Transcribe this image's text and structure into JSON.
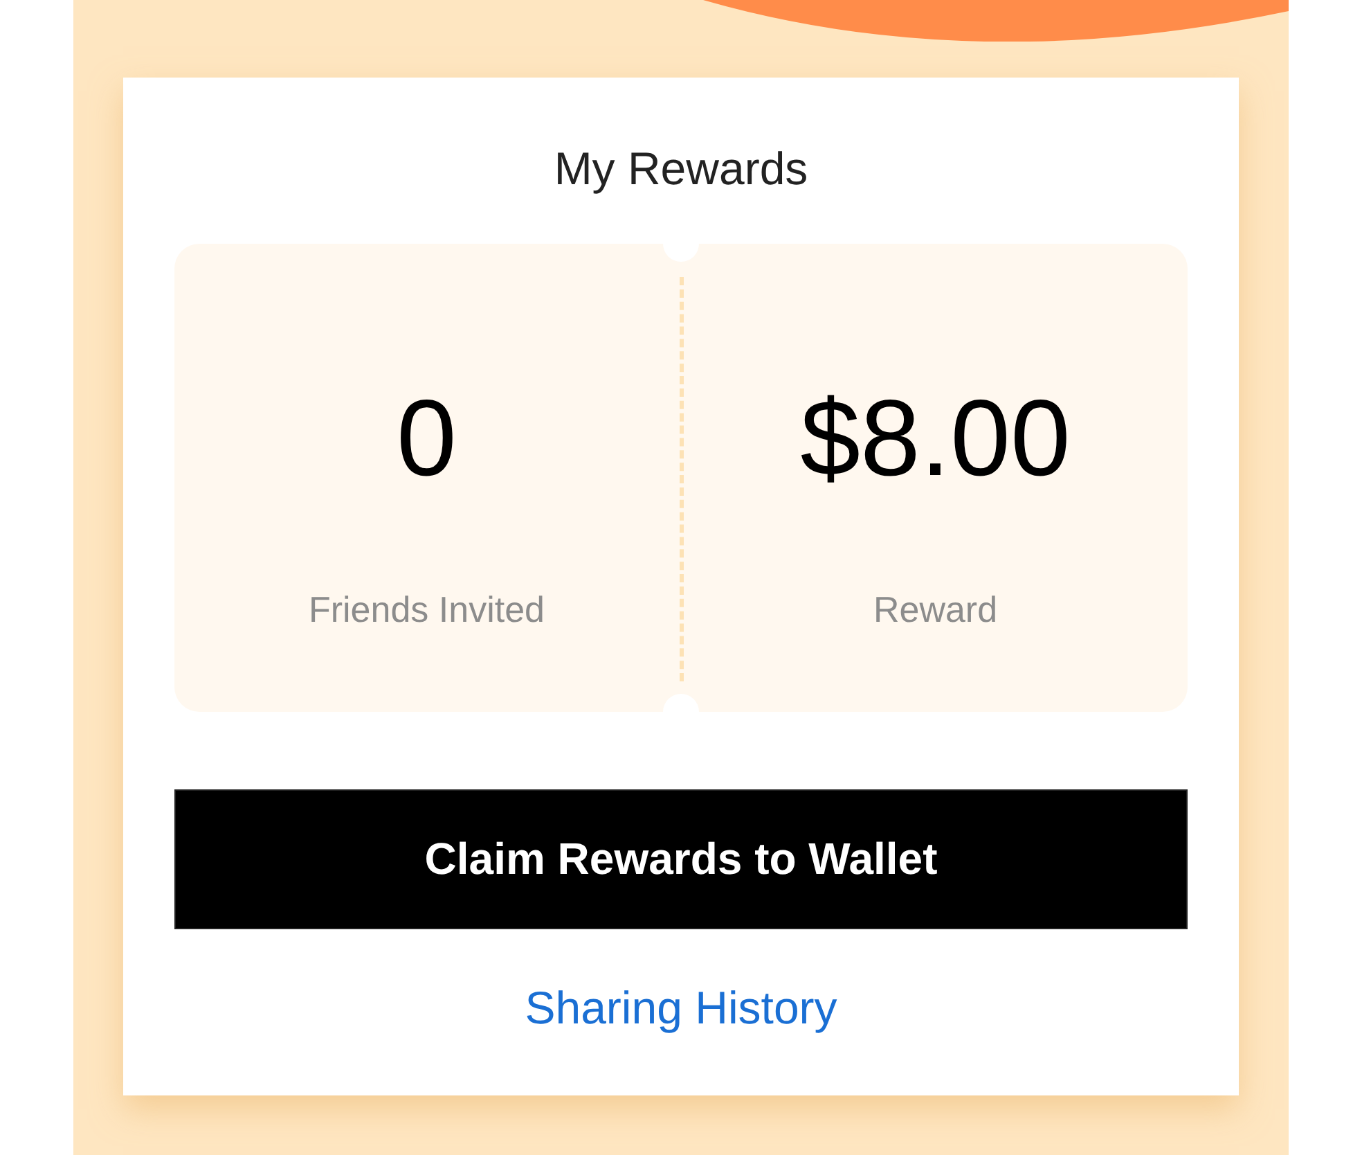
{
  "card": {
    "title": "My Rewards"
  },
  "stats": [
    {
      "value": "0",
      "label": "Friends Invited"
    },
    {
      "value": "$8.00",
      "label": "Reward"
    }
  ],
  "claim_button": {
    "label": "Claim Rewards to Wallet"
  },
  "history_link": {
    "label": "Sharing History"
  }
}
